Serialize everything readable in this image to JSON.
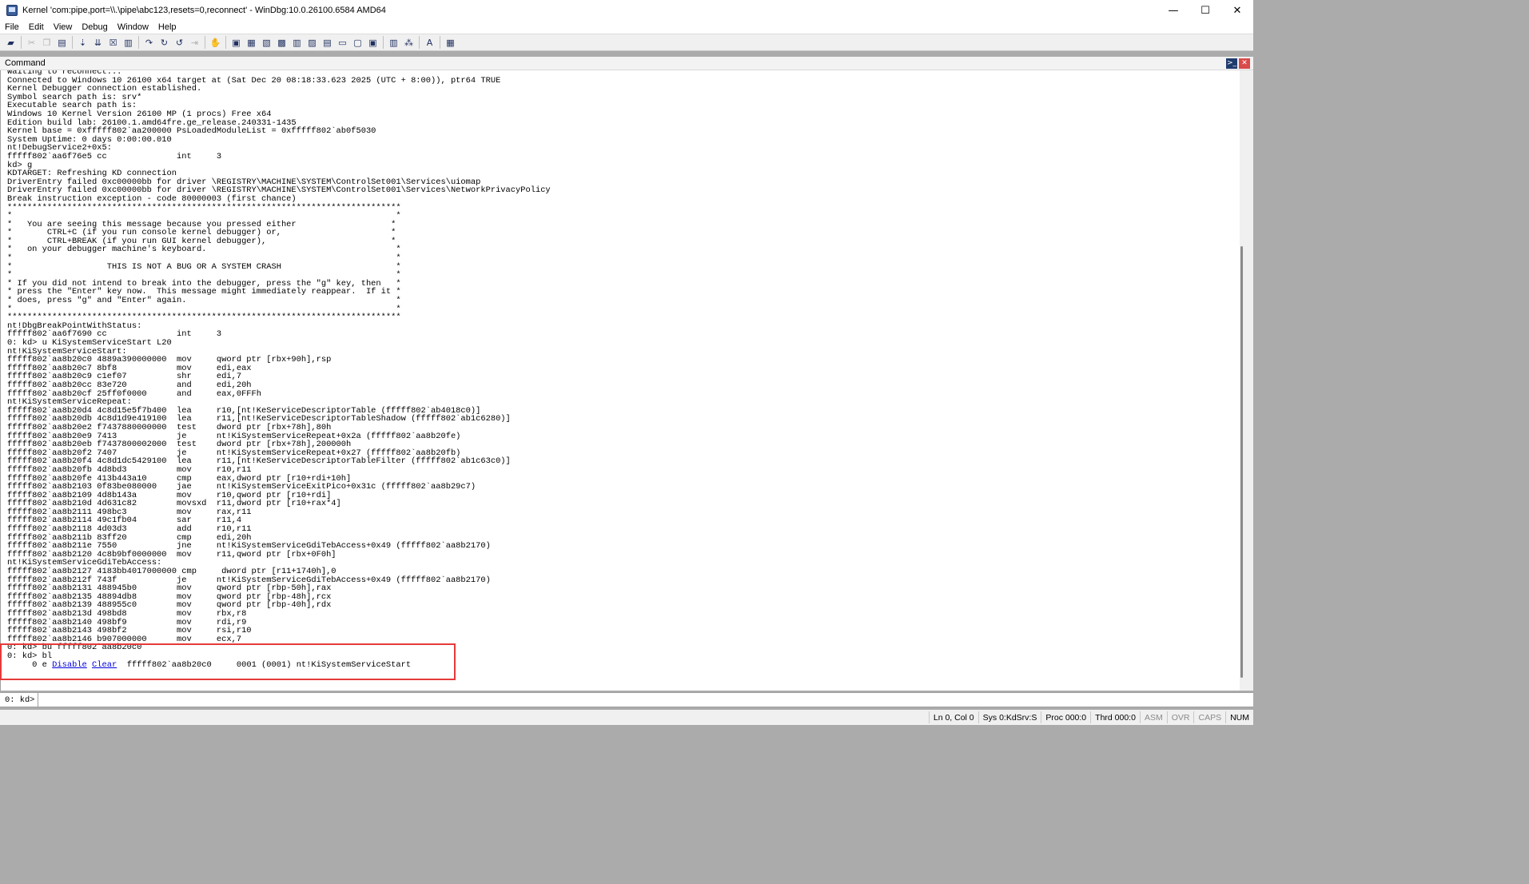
{
  "window": {
    "title": "Kernel 'com:pipe,port=\\\\.\\pipe\\abc123,resets=0,reconnect' - WinDbg:10.0.26100.6584 AMD64",
    "minimize": "—",
    "maximize": "☐",
    "close": "✕"
  },
  "menu": [
    "File",
    "Edit",
    "View",
    "Debug",
    "Window",
    "Help"
  ],
  "toolbar": {
    "icons": [
      "open-icon",
      "cut-icon",
      "copy-icon",
      "paste-icon",
      "go-icon",
      "restart-icon",
      "stop-debugging-icon",
      "break-icon",
      "step-into-icon",
      "step-over-icon",
      "step-out-icon",
      "run-to-cursor-icon",
      "source-mode-icon",
      "command-window-icon",
      "watch-window-icon",
      "locals-window-icon",
      "registers-window-icon",
      "memory-window-icon",
      "call-stack-icon",
      "disassembly-icon",
      "scratch-pad-icon",
      "processes-threads-icon",
      "source-mode-on-icon",
      "hex-mode-icon",
      "font-icon",
      "options-icon"
    ]
  },
  "command": {
    "header": "Command",
    "lines": [
      "Waiting to reconnect...",
      "Connected to Windows 10 26100 x64 target at (Sat Dec 20 08:18:33.623 2025 (UTC + 8:00)), ptr64 TRUE",
      "Kernel Debugger connection established.",
      "Symbol search path is: srv*",
      "Executable search path is:",
      "Windows 10 Kernel Version 26100 MP (1 procs) Free x64",
      "Edition build lab: 26100.1.amd64fre.ge_release.240331-1435",
      "Kernel base = 0xfffff802`aa200000 PsLoadedModuleList = 0xfffff802`ab0f5030",
      "System Uptime: 0 days 0:00:00.010",
      "nt!DebugService2+0x5:",
      "fffff802`aa6f76e5 cc              int     3",
      "kd> g",
      "KDTARGET: Refreshing KD connection",
      "DriverEntry failed 0xc00000bb for driver \\REGISTRY\\MACHINE\\SYSTEM\\ControlSet001\\Services\\uiomap",
      "DriverEntry failed 0xc00000bb for driver \\REGISTRY\\MACHINE\\SYSTEM\\ControlSet001\\Services\\NetworkPrivacyPolicy",
      "Break instruction exception - code 80000003 (first chance)",
      "*******************************************************************************",
      "*                                                                             *",
      "*   You are seeing this message because you pressed either                   *",
      "*       CTRL+C (if you run console kernel debugger) or,                      *",
      "*       CTRL+BREAK (if you run GUI kernel debugger),                         *",
      "*   on your debugger machine's keyboard.                                      *",
      "*                                                                             *",
      "*                   THIS IS NOT A BUG OR A SYSTEM CRASH                       *",
      "*                                                                             *",
      "* If you did not intend to break into the debugger, press the \"g\" key, then   *",
      "* press the \"Enter\" key now.  This message might immediately reappear.  If it *",
      "* does, press \"g\" and \"Enter\" again.                                          *",
      "*                                                                             *",
      "*******************************************************************************",
      "nt!DbgBreakPointWithStatus:",
      "fffff802`aa6f7690 cc              int     3",
      "0: kd> u KiSystemServiceStart L20",
      "nt!KiSystemServiceStart:",
      "fffff802`aa8b20c0 4889a390000000  mov     qword ptr [rbx+90h],rsp",
      "fffff802`aa8b20c7 8bf8            mov     edi,eax",
      "fffff802`aa8b20c9 c1ef07          shr     edi,7",
      "fffff802`aa8b20cc 83e720          and     edi,20h",
      "fffff802`aa8b20cf 25ff0f0000      and     eax,0FFFh",
      "nt!KiSystemServiceRepeat:",
      "fffff802`aa8b20d4 4c8d15e5f7b400  lea     r10,[nt!KeServiceDescriptorTable (fffff802`ab4018c0)]",
      "fffff802`aa8b20db 4c8d1d9e419100  lea     r11,[nt!KeServiceDescriptorTableShadow (fffff802`ab1c6280)]",
      "fffff802`aa8b20e2 f7437880000000  test    dword ptr [rbx+78h],80h",
      "fffff802`aa8b20e9 7413            je      nt!KiSystemServiceRepeat+0x2a (fffff802`aa8b20fe)",
      "fffff802`aa8b20eb f7437800002000  test    dword ptr [rbx+78h],200000h",
      "fffff802`aa8b20f2 7407            je      nt!KiSystemServiceRepeat+0x27 (fffff802`aa8b20fb)",
      "fffff802`aa8b20f4 4c8d1dc5429100  lea     r11,[nt!KeServiceDescriptorTableFilter (fffff802`ab1c63c0)]",
      "fffff802`aa8b20fb 4d8bd3          mov     r10,r11",
      "fffff802`aa8b20fe 413b443a10      cmp     eax,dword ptr [r10+rdi+10h]",
      "fffff802`aa8b2103 0f83be080000    jae     nt!KiSystemServiceExitPico+0x31c (fffff802`aa8b29c7)",
      "fffff802`aa8b2109 4d8b143a        mov     r10,qword ptr [r10+rdi]",
      "fffff802`aa8b210d 4d631c82        movsxd  r11,dword ptr [r10+rax*4]",
      "fffff802`aa8b2111 498bc3          mov     rax,r11",
      "fffff802`aa8b2114 49c1fb04        sar     r11,4",
      "fffff802`aa8b2118 4d03d3          add     r10,r11",
      "fffff802`aa8b211b 83ff20          cmp     edi,20h",
      "fffff802`aa8b211e 7550            jne     nt!KiSystemServiceGdiTebAccess+0x49 (fffff802`aa8b2170)",
      "fffff802`aa8b2120 4c8b9bf0000000  mov     r11,qword ptr [rbx+0F0h]",
      "nt!KiSystemServiceGdiTebAccess:",
      "fffff802`aa8b2127 4183bb4017000000 cmp     dword ptr [r11+1740h],0",
      "fffff802`aa8b212f 743f            je      nt!KiSystemServiceGdiTebAccess+0x49 (fffff802`aa8b2170)",
      "fffff802`aa8b2131 488945b0        mov     qword ptr [rbp-50h],rax",
      "fffff802`aa8b2135 48894db8        mov     qword ptr [rbp-48h],rcx",
      "fffff802`aa8b2139 488955c0        mov     qword ptr [rbp-40h],rdx",
      "fffff802`aa8b213d 498bd8          mov     rbx,r8",
      "fffff802`aa8b2140 498bf9          mov     rdi,r9",
      "fffff802`aa8b2143 498bf2          mov     rsi,r10",
      "fffff802`aa8b2146 b907000000      mov     ecx,7",
      "0: kd> bu fffff802`aa8b20c0",
      "0: kd> bl"
    ],
    "bp_line": {
      "prefix": "     0 e ",
      "disable": "Disable",
      "clear": "Clear",
      "suffix": "  fffff802`aa8b20c0     0001 (0001) nt!KiSystemServiceStart"
    }
  },
  "input": {
    "prompt": "0: kd>",
    "value": ""
  },
  "status": {
    "items": [
      "Ln 0, Col 0",
      "Sys 0:KdSrv:S",
      "Proc 000:0",
      "Thrd 000:0",
      "ASM",
      "OVR",
      "CAPS",
      "NUM"
    ],
    "dim": [
      false,
      false,
      false,
      false,
      true,
      true,
      true,
      false
    ]
  }
}
